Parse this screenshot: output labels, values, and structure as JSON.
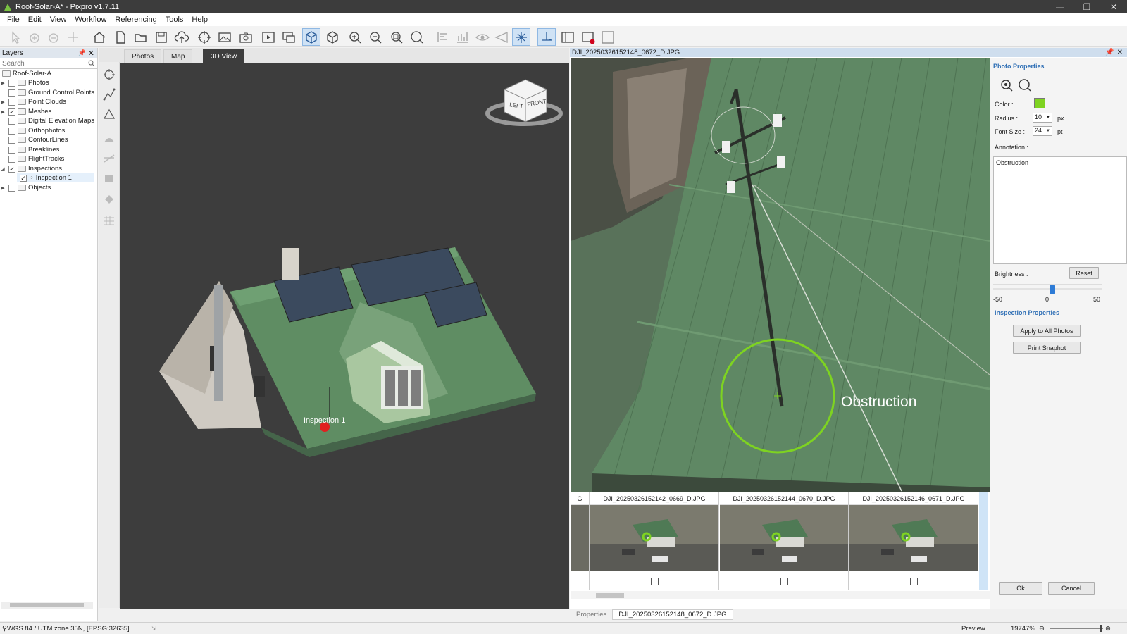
{
  "window": {
    "title": "Roof-Solar-A* - Pixpro v1.7.11",
    "minimize": "—",
    "maximize": "❐",
    "close": "✕"
  },
  "menu": [
    "File",
    "Edit",
    "View",
    "Workflow",
    "Referencing",
    "Tools",
    "Help"
  ],
  "layers": {
    "title": "Layers",
    "search_placeholder": "Search",
    "root": "Roof-Solar-A",
    "items": [
      {
        "label": "Photos",
        "checked": false,
        "expandable": true
      },
      {
        "label": "Ground Control Points",
        "checked": false,
        "expandable": false
      },
      {
        "label": "Point Clouds",
        "checked": false,
        "expandable": true
      },
      {
        "label": "Meshes",
        "checked": true,
        "expandable": true
      },
      {
        "label": "Digital Elevation Maps",
        "checked": false,
        "expandable": false
      },
      {
        "label": "Orthophotos",
        "checked": false,
        "expandable": false
      },
      {
        "label": "ContourLines",
        "checked": false,
        "expandable": false
      },
      {
        "label": "Breaklines",
        "checked": false,
        "expandable": false
      },
      {
        "label": "FlightTracks",
        "checked": false,
        "expandable": false
      },
      {
        "label": "Inspections",
        "checked": true,
        "expandable": true,
        "expanded": true
      },
      {
        "label": "Inspection 1",
        "checked": true,
        "expandable": false,
        "child": true,
        "selected": true
      },
      {
        "label": "Objects",
        "checked": false,
        "expandable": true
      }
    ]
  },
  "view_tabs": [
    "Photos",
    "Map",
    "3D View"
  ],
  "view3d": {
    "marker_label": "Inspection 1",
    "cube_left": "LEFT",
    "cube_front": "FRONT"
  },
  "photo": {
    "filename": "DJI_20250326152148_0672_D.JPG",
    "annotation_label": "Obstruction",
    "annotation_color": "#7ed321"
  },
  "photo_properties": {
    "title": "Photo Properties",
    "color_label": "Color :",
    "color_value": "#7ed321",
    "radius_label": "Radius :",
    "radius_value": "10",
    "radius_unit": "px",
    "font_size_label": "Font Size :",
    "font_size_value": "24",
    "font_size_unit": "pt",
    "annotation_label": "Annotation :",
    "annotation_text": "Obstruction",
    "brightness_label": "Brightness :",
    "reset_label": "Reset",
    "brightness_min": "-50",
    "brightness_mid": "0",
    "brightness_max": "50",
    "brightness_value": 5,
    "inspection_title": "Inspection Properties",
    "apply_all_label": "Apply to All Photos",
    "print_label": "Print Snaphot",
    "ok_label": "Ok",
    "cancel_label": "Cancel"
  },
  "filmstrip": {
    "partial": "G",
    "items": [
      "DJI_20250326152142_0669_D.JPG",
      "DJI_20250326152144_0670_D.JPG",
      "DJI_20250326152146_0671_D.JPG"
    ]
  },
  "bottom_tabs": [
    "Properties",
    "DJI_20250326152148_0672_D.JPG"
  ],
  "status": {
    "crs": "WGS 84 / UTM zone 35N, [EPSG:32635]",
    "preview": "Preview",
    "zoom": "19747%"
  }
}
